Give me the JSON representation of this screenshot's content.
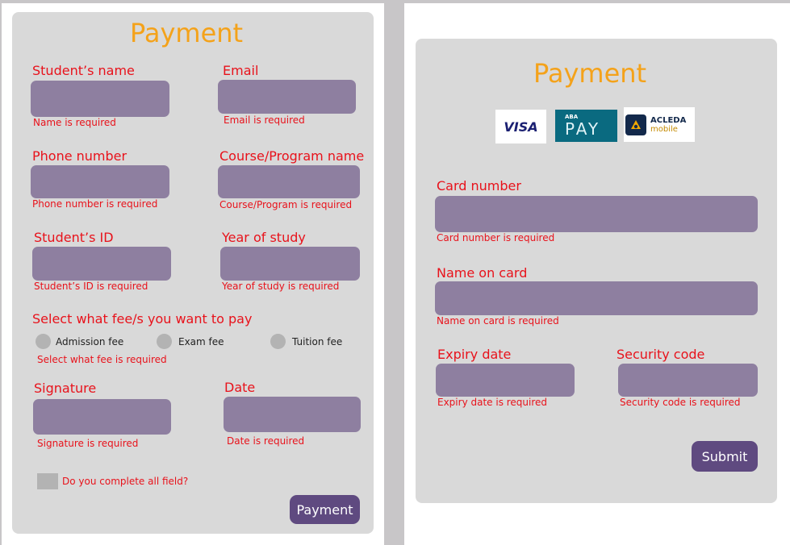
{
  "colors": {
    "accent_title": "#f4a21a",
    "error": "#e8121b",
    "input_fill": "#8e7fa0",
    "button": "#5f4a80",
    "card": "#d9d9d9"
  },
  "left_form": {
    "title": "Payment",
    "student_name": {
      "label": "Student’s name",
      "error": "Name is required"
    },
    "email": {
      "label": "Email",
      "error": "Email is required"
    },
    "phone": {
      "label": "Phone number",
      "error": "Phone number is required"
    },
    "course": {
      "label": "Course/Program name",
      "error": "Course/Program  is required"
    },
    "student_id": {
      "label": "Student’s ID",
      "error": "Student’s ID is required"
    },
    "year": {
      "label": "Year of study",
      "error": "Year of study is required"
    },
    "fee_select": {
      "label": "Select what fee/s you want to pay",
      "options": [
        "Admission fee",
        "Exam fee",
        "Tuition fee"
      ],
      "error": "Select what fee is required"
    },
    "signature": {
      "label": "Signature",
      "error": "Signature is required"
    },
    "date": {
      "label": "Date",
      "error": "Date is required"
    },
    "confirm_checkbox": "Do you complete all field?",
    "submit_label": "Payment"
  },
  "right_form": {
    "title": "Payment",
    "logos": {
      "visa": "VISA",
      "aba_top": "ABA",
      "aba_main": "PAY",
      "acleda_top": "ACLEDA",
      "acleda_bottom": "mobile"
    },
    "card_number": {
      "label": "Card number",
      "error": "Card number is required"
    },
    "name_on_card": {
      "label": "Name on card",
      "error": "Name on card is required"
    },
    "expiry": {
      "label": "Expiry date",
      "error": "Expiry date is required"
    },
    "security": {
      "label": "Security code",
      "error": "Security code is required"
    },
    "submit_label": "Submit"
  }
}
